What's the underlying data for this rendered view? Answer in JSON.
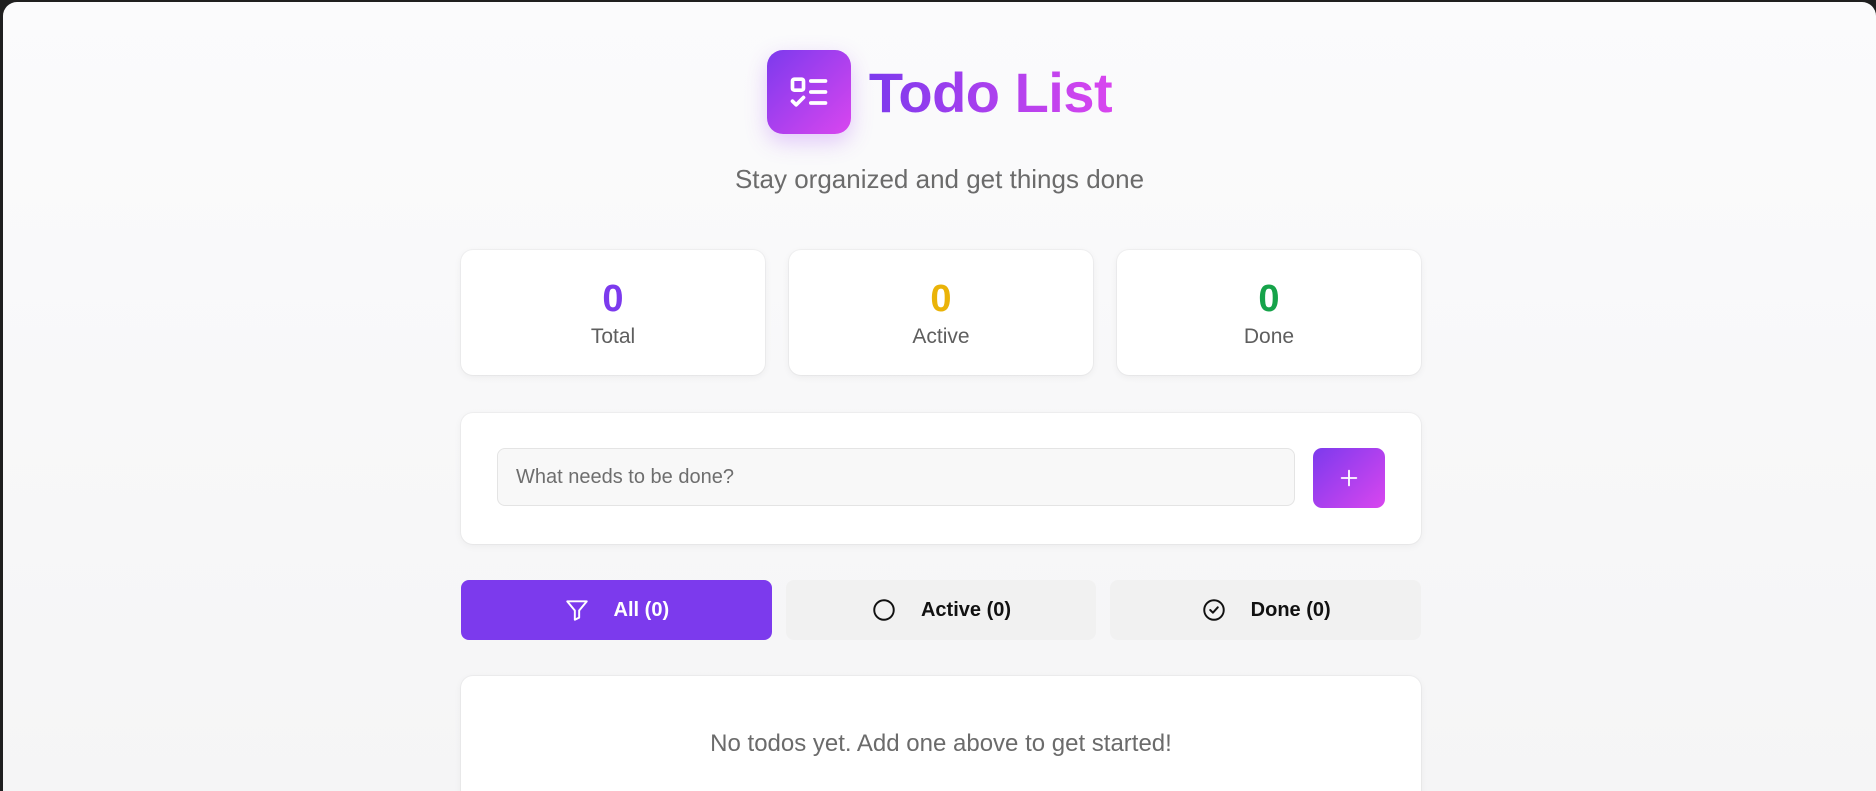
{
  "app": {
    "title": "Todo List",
    "subtitle": "Stay organized and get things done",
    "logo_icon": "checklist-icon"
  },
  "colors": {
    "accent_start": "#7c3aed",
    "accent_end": "#d946ef",
    "total": "#7c3aed",
    "active": "#eab308",
    "done": "#16a34a"
  },
  "stats": {
    "total": {
      "value": "0",
      "label": "Total"
    },
    "active": {
      "value": "0",
      "label": "Active"
    },
    "done": {
      "value": "0",
      "label": "Done"
    }
  },
  "add_form": {
    "placeholder": "What needs to be done?",
    "value": "",
    "button_label": "+",
    "button_icon": "plus-icon"
  },
  "filters": [
    {
      "label": "All (0)",
      "icon": "filter-icon",
      "selected": true
    },
    {
      "label": "Active (0)",
      "icon": "circle-icon",
      "selected": false
    },
    {
      "label": "Done (0)",
      "icon": "check-circle-icon",
      "selected": false
    }
  ],
  "empty_state": {
    "message": "No todos yet. Add one above to get started!"
  }
}
